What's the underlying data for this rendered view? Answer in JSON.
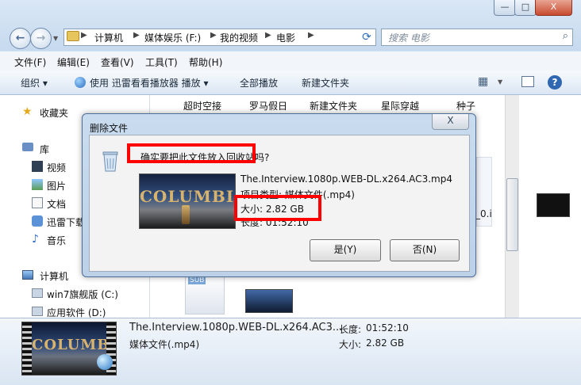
{
  "window": {
    "minimize": "—",
    "maximize": "□",
    "close": "X"
  },
  "address": {
    "crumbs": [
      "计算机",
      "媒体娱乐 (F:)",
      "我的视频",
      "电影"
    ],
    "search_placeholder": "搜索 电影"
  },
  "menu": [
    "文件(F)",
    "编辑(E)",
    "查看(V)",
    "工具(T)",
    "帮助(H)"
  ],
  "toolbar": {
    "organize": "组织 ▾",
    "play_with": "使用 迅雷看看播放器 播放 ▾",
    "play_all": "全部播放",
    "new_folder": "新建文件夹"
  },
  "sidebar": {
    "favorites": "收藏夹",
    "library": "库",
    "videos": "视频",
    "pictures": "图片",
    "documents": "文档",
    "thunder": "迅雷下载",
    "music": "音乐",
    "computer": "计算机",
    "drive_c": "win7旗舰版 (C:)",
    "drive_d": "应用软件 (D:)"
  },
  "folders": [
    "超时空接",
    "罗马假日",
    "新建文件夹",
    "星际穿越",
    "种子"
  ],
  "content_extra": {
    "partial_label": "_0.i",
    "sub_label": "SUB"
  },
  "dialog": {
    "title": "删除文件",
    "close": "X",
    "question": "确实要把此文件放入回收站吗?",
    "file_name": "The.Interview.1080p.WEB-DL.x264.AC3.mp4",
    "type": "项目类型: 媒体文件(.mp4)",
    "size": "大小: 2.82 GB",
    "length": "长度: 01:52:10",
    "yes": "是(Y)",
    "no": "否(N)",
    "thumb_logo": "COLUMBIA"
  },
  "details": {
    "file_name": "The.Interview.1080p.WEB-DL.x264.AC3...",
    "type": "媒体文件(.mp4)",
    "length_label": "长度:",
    "length": "01:52:10",
    "size_label": "大小:",
    "size": "2.82 GB",
    "thumb_logo": "COLUMBIA"
  },
  "colors": {
    "highlight": "#ff0000",
    "accent": "#2f67b1"
  }
}
